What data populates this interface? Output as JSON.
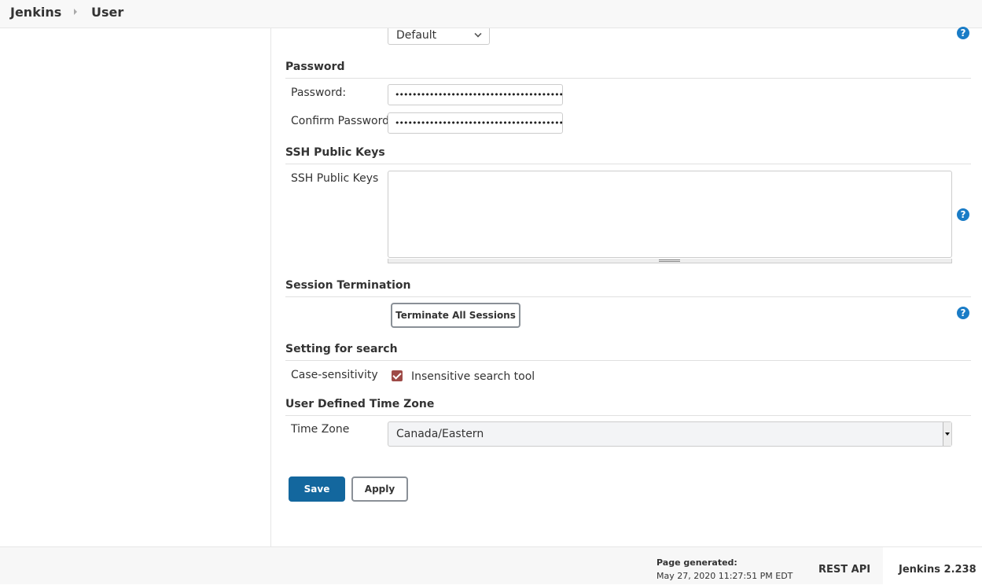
{
  "breadcrumb": {
    "items": [
      {
        "label": "Jenkins"
      },
      {
        "label": "User"
      }
    ]
  },
  "theme": {
    "accent": "#13679e",
    "help_icon": "#1a7cc6",
    "checkbox": "#9e4a47"
  },
  "top_select": {
    "value": "Default",
    "icon": "chevron-down-icon"
  },
  "password": {
    "title": "Password",
    "password_label": "Password:",
    "password_value": "••••••••••••••••••••••••••••••••••••••••••",
    "confirm_label": "Confirm Password:",
    "confirm_value": "••••••••••••••••••••••••••••••••••••••••••"
  },
  "ssh": {
    "title": "SSH Public Keys",
    "label": "SSH Public Keys",
    "value": ""
  },
  "session": {
    "title": "Session Termination",
    "button_label": "Terminate All Sessions"
  },
  "search": {
    "title": "Setting for search",
    "label": "Case-sensitivity",
    "checkbox_label": "Insensitive search tool",
    "checked": true
  },
  "timezone": {
    "title": "User Defined Time Zone",
    "label": "Time Zone",
    "value": "Canada/Eastern"
  },
  "actions": {
    "save_label": "Save",
    "apply_label": "Apply"
  },
  "help_icon": {
    "glyph": "?"
  },
  "footer": {
    "generated_label": "Page generated:",
    "generated_date": "May 27, 2020 11:27:51 PM EDT",
    "rest_api_label": "REST API",
    "version_label": "Jenkins 2.238"
  }
}
